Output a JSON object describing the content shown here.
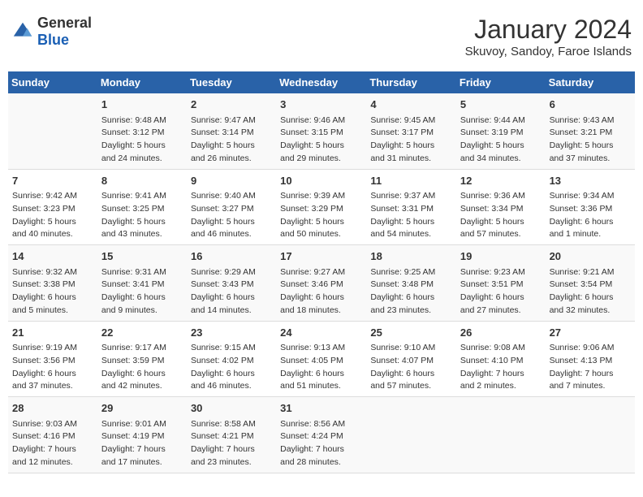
{
  "logo": {
    "general": "General",
    "blue": "Blue"
  },
  "header": {
    "month": "January 2024",
    "location": "Skuvoy, Sandoy, Faroe Islands"
  },
  "weekdays": [
    "Sunday",
    "Monday",
    "Tuesday",
    "Wednesday",
    "Thursday",
    "Friday",
    "Saturday"
  ],
  "weeks": [
    [
      {
        "day": "",
        "info": ""
      },
      {
        "day": "1",
        "info": "Sunrise: 9:48 AM\nSunset: 3:12 PM\nDaylight: 5 hours\nand 24 minutes."
      },
      {
        "day": "2",
        "info": "Sunrise: 9:47 AM\nSunset: 3:14 PM\nDaylight: 5 hours\nand 26 minutes."
      },
      {
        "day": "3",
        "info": "Sunrise: 9:46 AM\nSunset: 3:15 PM\nDaylight: 5 hours\nand 29 minutes."
      },
      {
        "day": "4",
        "info": "Sunrise: 9:45 AM\nSunset: 3:17 PM\nDaylight: 5 hours\nand 31 minutes."
      },
      {
        "day": "5",
        "info": "Sunrise: 9:44 AM\nSunset: 3:19 PM\nDaylight: 5 hours\nand 34 minutes."
      },
      {
        "day": "6",
        "info": "Sunrise: 9:43 AM\nSunset: 3:21 PM\nDaylight: 5 hours\nand 37 minutes."
      }
    ],
    [
      {
        "day": "7",
        "info": "Sunrise: 9:42 AM\nSunset: 3:23 PM\nDaylight: 5 hours\nand 40 minutes."
      },
      {
        "day": "8",
        "info": "Sunrise: 9:41 AM\nSunset: 3:25 PM\nDaylight: 5 hours\nand 43 minutes."
      },
      {
        "day": "9",
        "info": "Sunrise: 9:40 AM\nSunset: 3:27 PM\nDaylight: 5 hours\nand 46 minutes."
      },
      {
        "day": "10",
        "info": "Sunrise: 9:39 AM\nSunset: 3:29 PM\nDaylight: 5 hours\nand 50 minutes."
      },
      {
        "day": "11",
        "info": "Sunrise: 9:37 AM\nSunset: 3:31 PM\nDaylight: 5 hours\nand 54 minutes."
      },
      {
        "day": "12",
        "info": "Sunrise: 9:36 AM\nSunset: 3:34 PM\nDaylight: 5 hours\nand 57 minutes."
      },
      {
        "day": "13",
        "info": "Sunrise: 9:34 AM\nSunset: 3:36 PM\nDaylight: 6 hours\nand 1 minute."
      }
    ],
    [
      {
        "day": "14",
        "info": "Sunrise: 9:32 AM\nSunset: 3:38 PM\nDaylight: 6 hours\nand 5 minutes."
      },
      {
        "day": "15",
        "info": "Sunrise: 9:31 AM\nSunset: 3:41 PM\nDaylight: 6 hours\nand 9 minutes."
      },
      {
        "day": "16",
        "info": "Sunrise: 9:29 AM\nSunset: 3:43 PM\nDaylight: 6 hours\nand 14 minutes."
      },
      {
        "day": "17",
        "info": "Sunrise: 9:27 AM\nSunset: 3:46 PM\nDaylight: 6 hours\nand 18 minutes."
      },
      {
        "day": "18",
        "info": "Sunrise: 9:25 AM\nSunset: 3:48 PM\nDaylight: 6 hours\nand 23 minutes."
      },
      {
        "day": "19",
        "info": "Sunrise: 9:23 AM\nSunset: 3:51 PM\nDaylight: 6 hours\nand 27 minutes."
      },
      {
        "day": "20",
        "info": "Sunrise: 9:21 AM\nSunset: 3:54 PM\nDaylight: 6 hours\nand 32 minutes."
      }
    ],
    [
      {
        "day": "21",
        "info": "Sunrise: 9:19 AM\nSunset: 3:56 PM\nDaylight: 6 hours\nand 37 minutes."
      },
      {
        "day": "22",
        "info": "Sunrise: 9:17 AM\nSunset: 3:59 PM\nDaylight: 6 hours\nand 42 minutes."
      },
      {
        "day": "23",
        "info": "Sunrise: 9:15 AM\nSunset: 4:02 PM\nDaylight: 6 hours\nand 46 minutes."
      },
      {
        "day": "24",
        "info": "Sunrise: 9:13 AM\nSunset: 4:05 PM\nDaylight: 6 hours\nand 51 minutes."
      },
      {
        "day": "25",
        "info": "Sunrise: 9:10 AM\nSunset: 4:07 PM\nDaylight: 6 hours\nand 57 minutes."
      },
      {
        "day": "26",
        "info": "Sunrise: 9:08 AM\nSunset: 4:10 PM\nDaylight: 7 hours\nand 2 minutes."
      },
      {
        "day": "27",
        "info": "Sunrise: 9:06 AM\nSunset: 4:13 PM\nDaylight: 7 hours\nand 7 minutes."
      }
    ],
    [
      {
        "day": "28",
        "info": "Sunrise: 9:03 AM\nSunset: 4:16 PM\nDaylight: 7 hours\nand 12 minutes."
      },
      {
        "day": "29",
        "info": "Sunrise: 9:01 AM\nSunset: 4:19 PM\nDaylight: 7 hours\nand 17 minutes."
      },
      {
        "day": "30",
        "info": "Sunrise: 8:58 AM\nSunset: 4:21 PM\nDaylight: 7 hours\nand 23 minutes."
      },
      {
        "day": "31",
        "info": "Sunrise: 8:56 AM\nSunset: 4:24 PM\nDaylight: 7 hours\nand 28 minutes."
      },
      {
        "day": "",
        "info": ""
      },
      {
        "day": "",
        "info": ""
      },
      {
        "day": "",
        "info": ""
      }
    ]
  ]
}
